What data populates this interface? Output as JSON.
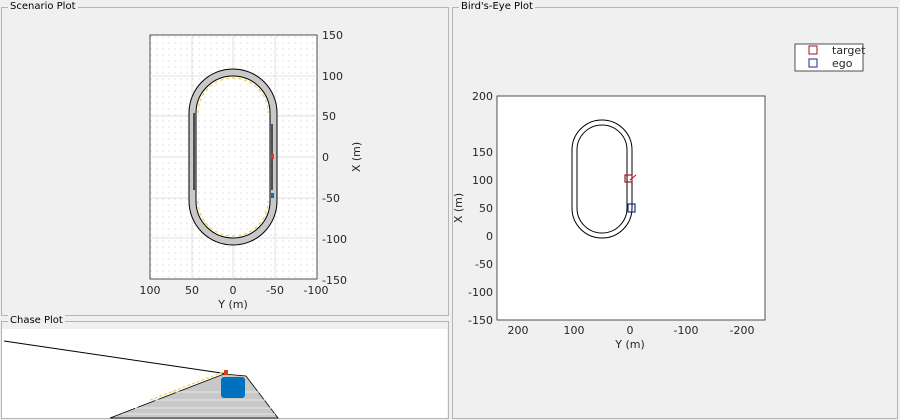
{
  "panels": {
    "scenario": {
      "title": "Scenario Plot",
      "xlabel": "Y (m)",
      "ylabel": "X (m)",
      "xticks": [
        "100",
        "50",
        "0",
        "-50",
        "-100"
      ],
      "yticks": [
        "150",
        "100",
        "50",
        "0",
        "-50",
        "-100",
        "-150"
      ]
    },
    "chase": {
      "title": "Chase Plot"
    },
    "birdseye": {
      "title": "Bird's-Eye Plot",
      "xlabel": "Y (m)",
      "ylabel": "X (m)",
      "xticks": [
        "200",
        "100",
        "0",
        "-100",
        "-200"
      ],
      "yticks": [
        "200",
        "150",
        "100",
        "50",
        "0",
        "-50",
        "-100",
        "-150",
        "-200"
      ],
      "legend": [
        {
          "label": "target",
          "color": "#a0141e"
        },
        {
          "label": "ego",
          "color": "#1e2a8c"
        }
      ]
    }
  },
  "colors": {
    "road": "#c8c8c8",
    "road_edge": "#000000",
    "lane_marking": "#f0d24a",
    "ego": "#0072bd",
    "target": "#d04020"
  }
}
